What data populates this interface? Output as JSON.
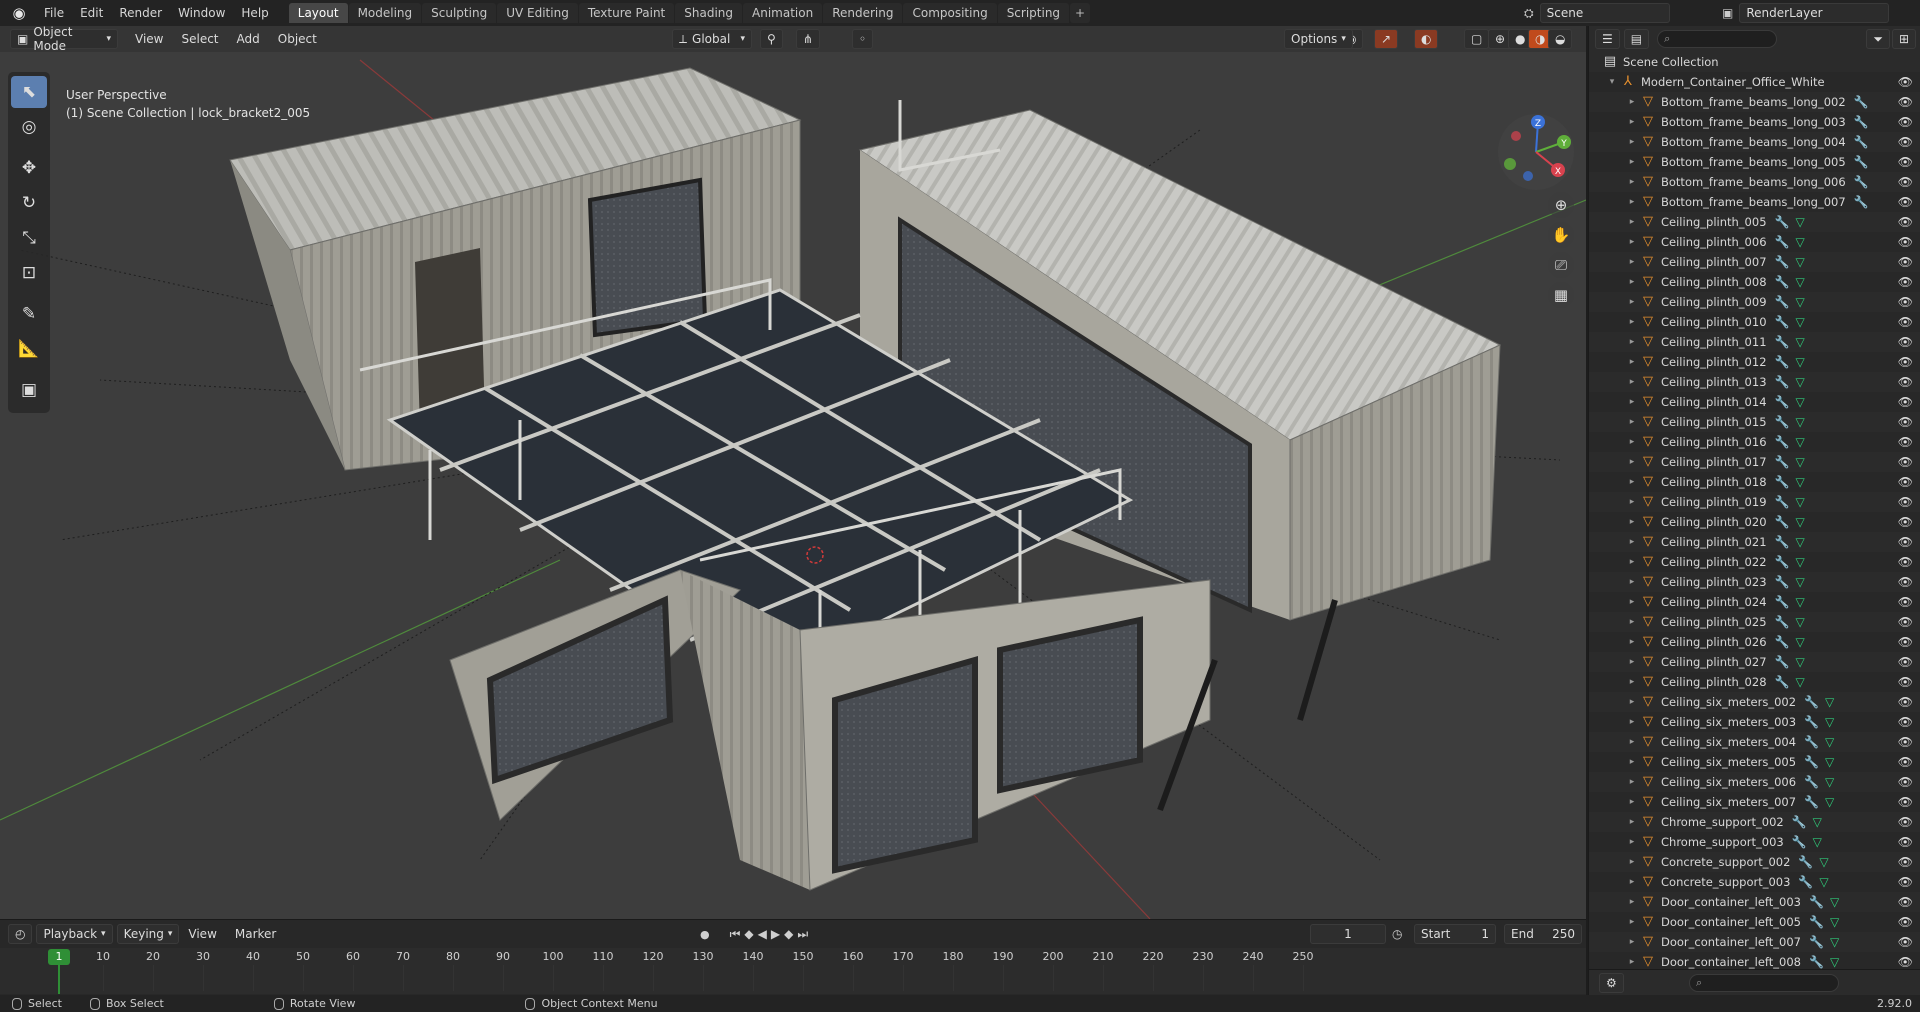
{
  "topbar": {
    "menus": [
      "File",
      "Edit",
      "Render",
      "Window",
      "Help"
    ],
    "workspaces": [
      "Layout",
      "Modeling",
      "Sculpting",
      "UV Editing",
      "Texture Paint",
      "Shading",
      "Animation",
      "Rendering",
      "Compositing",
      "Scripting"
    ],
    "active_workspace": "Layout",
    "add_tab": "+",
    "scene_label": "Scene",
    "layer_label": "RenderLayer"
  },
  "viewport": {
    "mode": "Object Mode",
    "menus": [
      "View",
      "Select",
      "Add",
      "Object"
    ],
    "orientation": "Global",
    "options_label": "Options",
    "info_line1": "User Perspective",
    "info_line2": "(1) Scene Collection | lock_bracket2_005",
    "gizmo": {
      "z": "Z",
      "y": "Y",
      "x": "X"
    }
  },
  "timeline": {
    "playback_label": "Playback",
    "keying_label": "Keying",
    "view_label": "View",
    "marker_label": "Marker",
    "current_frame": "1",
    "start_label": "Start",
    "start_value": "1",
    "end_label": "End",
    "end_value": "250",
    "ticks": [
      "10",
      "20",
      "30",
      "40",
      "50",
      "60",
      "70",
      "80",
      "90",
      "100",
      "110",
      "120",
      "130",
      "140",
      "150",
      "160",
      "170",
      "180",
      "190",
      "200",
      "210",
      "220",
      "230",
      "240",
      "250"
    ],
    "playhead": "1"
  },
  "statusbar": {
    "select": "Select",
    "box_select": "Box Select",
    "rotate_view": "Rotate View",
    "context_menu": "Object Context Menu",
    "version": "2.92.0"
  },
  "outliner": {
    "scene_collection": "Scene Collection",
    "collection": "Modern_Container_Office_White",
    "objects": [
      "Bottom_frame_beams_long_002",
      "Bottom_frame_beams_long_003",
      "Bottom_frame_beams_long_004",
      "Bottom_frame_beams_long_005",
      "Bottom_frame_beams_long_006",
      "Bottom_frame_beams_long_007",
      "Ceiling_plinth_005",
      "Ceiling_plinth_006",
      "Ceiling_plinth_007",
      "Ceiling_plinth_008",
      "Ceiling_plinth_009",
      "Ceiling_plinth_010",
      "Ceiling_plinth_011",
      "Ceiling_plinth_012",
      "Ceiling_plinth_013",
      "Ceiling_plinth_014",
      "Ceiling_plinth_015",
      "Ceiling_plinth_016",
      "Ceiling_plinth_017",
      "Ceiling_plinth_018",
      "Ceiling_plinth_019",
      "Ceiling_plinth_020",
      "Ceiling_plinth_021",
      "Ceiling_plinth_022",
      "Ceiling_plinth_023",
      "Ceiling_plinth_024",
      "Ceiling_plinth_025",
      "Ceiling_plinth_026",
      "Ceiling_plinth_027",
      "Ceiling_plinth_028",
      "Ceiling_six_meters_002",
      "Ceiling_six_meters_003",
      "Ceiling_six_meters_004",
      "Ceiling_six_meters_005",
      "Ceiling_six_meters_006",
      "Ceiling_six_meters_007",
      "Chrome_support_002",
      "Chrome_support_003",
      "Concrete_support_002",
      "Concrete_support_003",
      "Door_container_left_003",
      "Door_container_left_005",
      "Door_container_left_007",
      "Door_container_left_008"
    ],
    "mesh_icon_from": 6
  }
}
